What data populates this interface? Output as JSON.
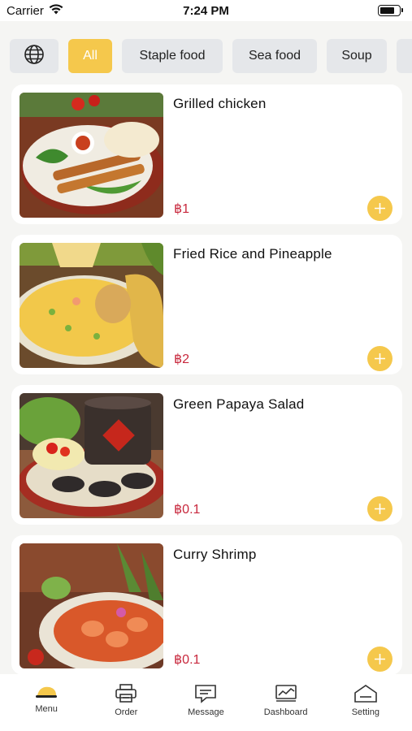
{
  "status": {
    "carrier": "Carrier",
    "time": "7:24 PM"
  },
  "categories": {
    "language_icon": "globe-icon",
    "items": [
      "All",
      "Staple food",
      "Sea food",
      "Soup"
    ],
    "selected": "All",
    "accent": "#f5c84c"
  },
  "menu": [
    {
      "name": "Grilled chicken",
      "price": "฿1",
      "image": "grilled chicken skewers plate"
    },
    {
      "name": "Fried Rice and Pineapple",
      "price": "฿2",
      "image": "pineapple fried rice plate"
    },
    {
      "name": "Green Papaya Salad",
      "price": "฿0.1",
      "image": "papaya salad with mortar"
    },
    {
      "name": "Curry Shrimp",
      "price": "฿0.1",
      "image": "curry shrimp plate"
    }
  ],
  "colors": {
    "price": "#c8283d",
    "add_button": "#f5c84c"
  },
  "tabs": [
    {
      "label": "Menu",
      "icon": "menu-dish-icon",
      "active": true
    },
    {
      "label": "Order",
      "icon": "printer-icon"
    },
    {
      "label": "Message",
      "icon": "message-icon"
    },
    {
      "label": "Dashboard",
      "icon": "chart-icon"
    },
    {
      "label": "Setting",
      "icon": "home-icon"
    }
  ]
}
